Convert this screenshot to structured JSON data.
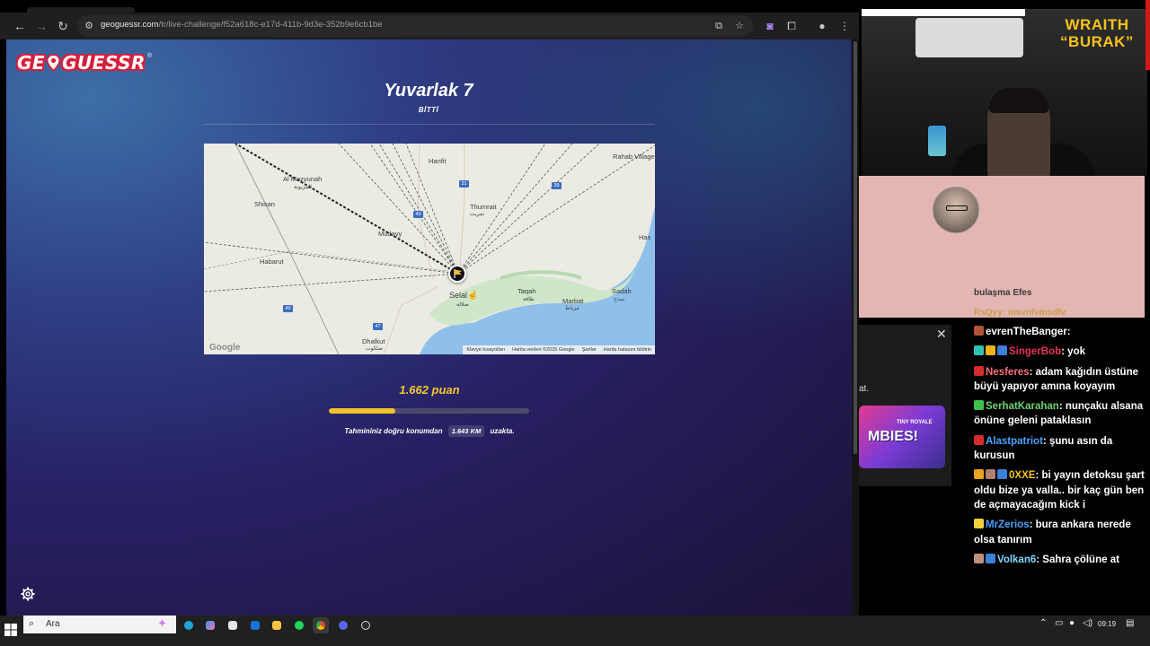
{
  "browser": {
    "url_host": "geoguessr.com",
    "url_path": "/tr/live-challenge/f52a618c-e17d-411b-9d3e-352b9e6cb1be"
  },
  "game": {
    "logo_left": "GE",
    "logo_right": "GUESSR",
    "logo_reg": "®",
    "round_title": "Yuvarlak 7",
    "round_status": "BİTTİ",
    "score": "1.662 puan",
    "score_fraction": 0.33,
    "distance_prefix": "Tahmininiz doğru konumdan",
    "distance_value": "1.643 KM",
    "distance_suffix": "uzakta."
  },
  "map": {
    "labels": {
      "hanfit": "Hanfit",
      "rahab": "Rahab Village",
      "almazyunah": "Al Mazyunah",
      "almazyunah_ar": "المزيونة",
      "shisan": "Shisan",
      "thumrait": "Thumrait",
      "thumrait_ar": "ثمريت",
      "mudayy": "Mudayy",
      "habarut": "Habarut",
      "salalah": "Selal",
      "salalah_ar": "صلالة",
      "taqah": "Taqah",
      "taqah_ar": "طاقة",
      "marbat": "Marbat",
      "marbat_ar": "مرباط",
      "sadah": "Sadah",
      "sadah_ar": "سدح",
      "has": "Has",
      "dhalkut": "Dhalkut",
      "dhalkut_ar": "ضلكوت"
    },
    "roads": {
      "r31": "31",
      "r39": "39",
      "r43": "43",
      "r47": "47",
      "r49": "49"
    },
    "google": "Google",
    "attribution": [
      "Klavye kısayolları",
      "Harita verileri ©2025 Google",
      "Şartlar",
      "Harita hatasını bildirin"
    ]
  },
  "stream": {
    "streamer_name_1": "WRAITH",
    "streamer_name_2": "“BURAK”",
    "ghost_1": "bulaşma Efes",
    "ghost_2": "RsQyy: msvnfvmsdfv",
    "popup_text": "at.",
    "popup_game_top": "TINY ROYALE",
    "popup_game_main": "MBIES!",
    "chat": [
      {
        "user": "evrenTheBanger",
        "color": "#ffffff",
        "msg": "",
        "badges": [
          "#b5523b"
        ]
      },
      {
        "user": "SingerBob",
        "color": "#e8345a",
        "msg": "yok",
        "badges": [
          "#2ec4b6",
          "#f0b31a",
          "#3b7fd6"
        ]
      },
      {
        "user": "Nesferes",
        "color": "#ff6f7a",
        "msg": "adam kağıdın üstüne büyü yapıyor amına koyayım",
        "badges": [
          "#d42c2c"
        ]
      },
      {
        "user": "SerhatKarahan",
        "color": "#6fd36f",
        "msg": "nunçaku alsana önüne geleni pataklasın",
        "badges": [
          "#3ec44e"
        ]
      },
      {
        "user": "Alastpatriot",
        "color": "#4aa3ff",
        "msg": "şunu asın da kurusun",
        "badges": [
          "#d42c2c"
        ]
      },
      {
        "user": "0XXE",
        "color": "#f5c518",
        "msg": "bi yayın detoksu şart oldu bize ya valla.. bir kaç gün ben de açmayacağım kick i",
        "badges": [
          "#f0a020",
          "#b08070",
          "#3b7fd6"
        ]
      },
      {
        "user": "MrZerios",
        "color": "#4aa3ff",
        "msg": "bura ankara nerede olsa tanırım",
        "badges": [
          "#f0d040"
        ]
      },
      {
        "user": "Volkan6",
        "color": "#7fd6ff",
        "msg": "Sahra çölüne at",
        "badges": [
          "#c09080",
          "#3b7fd6"
        ]
      }
    ]
  },
  "taskbar": {
    "search_label": "Ara",
    "time": "09:19"
  }
}
